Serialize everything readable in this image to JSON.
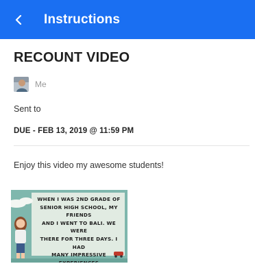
{
  "appbar": {
    "title": "Instructions"
  },
  "assignment": {
    "title": "RECOUNT VIDEO",
    "author": "Me",
    "sent_to_label": "Sent to",
    "due": "DUE - FEB 13, 2019 @ 11:59 PM",
    "message": "Enjoy this video my awesome students!"
  },
  "attachment": {
    "caption": "When I was 2nd grade of\nsenior high school, my friends\nand I went to Bali. We were\nthere for three days. I had\nmany impressive experiences\nduring the vacation."
  },
  "colors": {
    "appbar": "#1a6ff2",
    "thumbnail_bg": "#7fb7ad"
  }
}
